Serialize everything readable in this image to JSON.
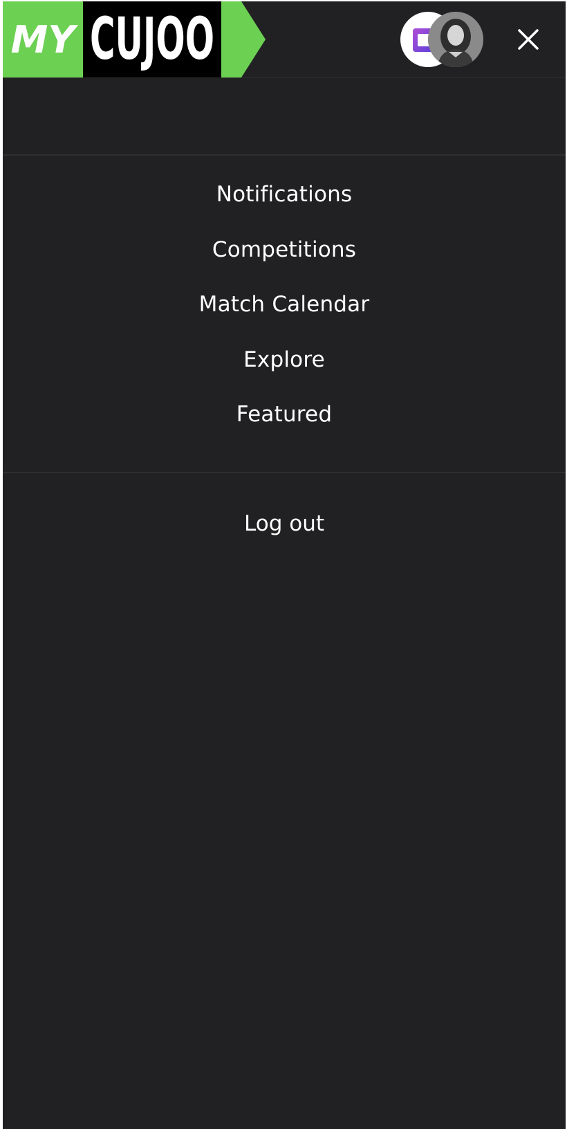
{
  "header": {
    "logo": {
      "text_my": "MY",
      "text_brand": "CUJOO",
      "green": "#6cd053",
      "black": "#000000"
    },
    "org_avatar_icon": "team-crest-icon",
    "user_avatar_icon": "user-photo",
    "close_icon": "close-icon"
  },
  "menu": {
    "items": [
      {
        "label": "Notifications"
      },
      {
        "label": "Competitions"
      },
      {
        "label": "Match Calendar"
      },
      {
        "label": "Explore"
      },
      {
        "label": "Featured"
      }
    ],
    "logout_label": "Log out"
  },
  "colors": {
    "background": "#212123",
    "divider": "#2f2f31",
    "text": "#ffffff",
    "accent": "#6cd053"
  }
}
